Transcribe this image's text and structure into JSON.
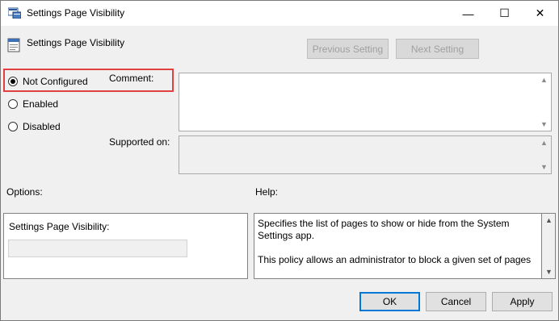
{
  "window": {
    "title": "Settings Page Visibility",
    "controls": {
      "minimize": "—",
      "maximize": "☐",
      "close": "✕"
    }
  },
  "policy": {
    "title": "Settings Page Visibility",
    "previous_label": "Previous Setting",
    "next_label": "Next Setting"
  },
  "state": {
    "options": [
      {
        "label": "Not Configured",
        "checked": true
      },
      {
        "label": "Enabled",
        "checked": false
      },
      {
        "label": "Disabled",
        "checked": false
      }
    ]
  },
  "comment": {
    "label": "Comment:",
    "value": ""
  },
  "supported": {
    "label": "Supported on:",
    "value": ""
  },
  "options_section": {
    "heading": "Options:",
    "field_label": "Settings Page Visibility:",
    "field_value": ""
  },
  "help_section": {
    "heading": "Help:",
    "paragraph1": "Specifies the list of pages to show or hide from the System Settings app.",
    "paragraph2": "This policy allows an administrator to block a given set of pages"
  },
  "buttons": {
    "ok": "OK",
    "cancel": "Cancel",
    "apply": "Apply"
  },
  "colors": {
    "highlight": "#e04040",
    "default_button_border": "#0078d7"
  }
}
